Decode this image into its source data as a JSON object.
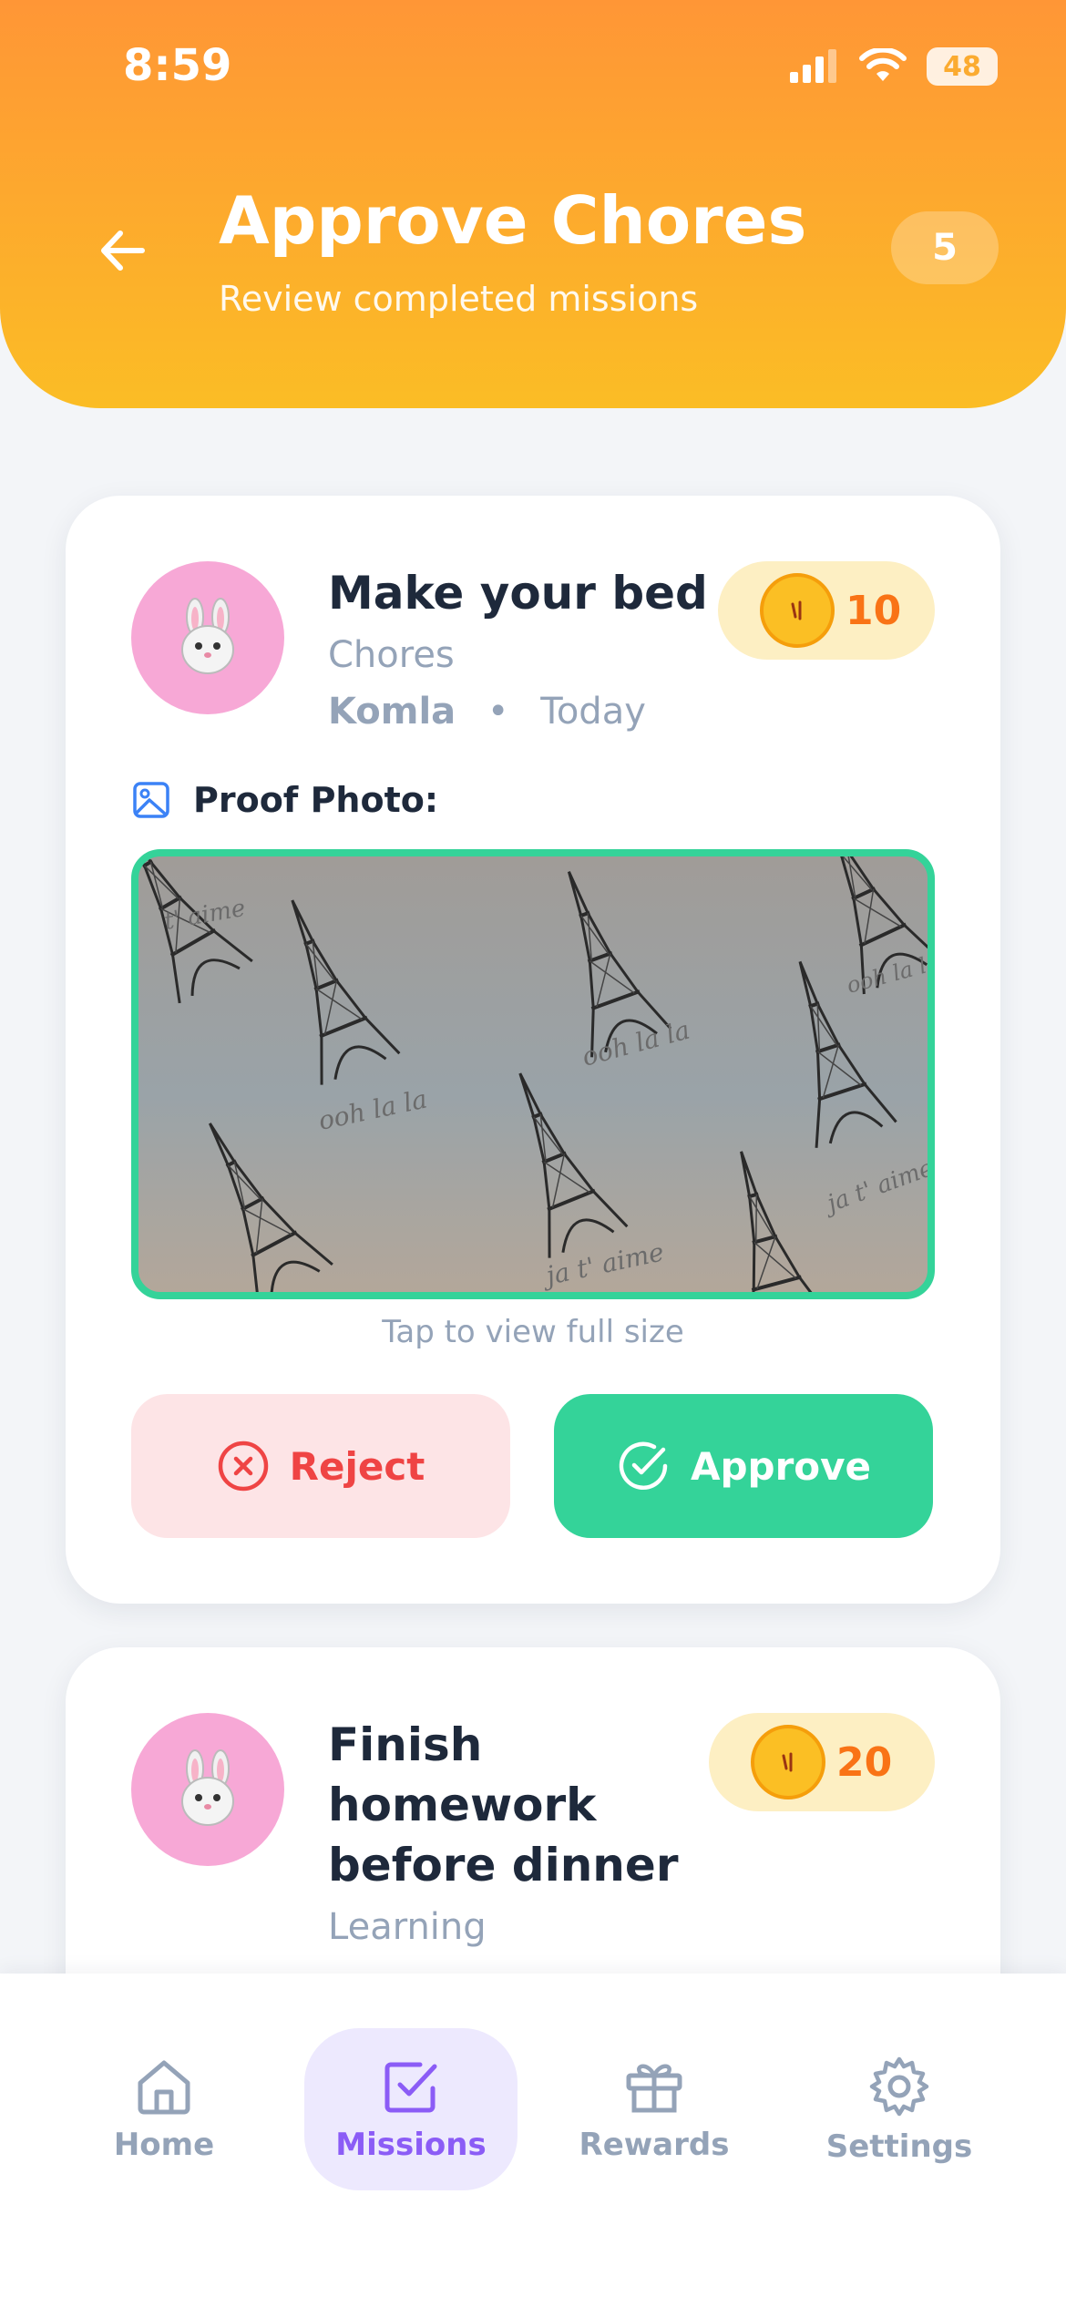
{
  "status_bar": {
    "time": "8:59",
    "battery": "48"
  },
  "header": {
    "title": "Approve Chores",
    "subtitle": "Review completed missions",
    "pending_count": "5"
  },
  "missions": [
    {
      "title": "Make your bed",
      "category": "Chores",
      "assignee": "Komla",
      "separator": "•",
      "date": "Today",
      "coins": "10",
      "proof_label": "Proof Photo:",
      "proof_caption_texts": [
        "t' aime",
        "ooh la la",
        "ooh la la",
        "ja t' aime",
        "ooh la la",
        "ja t' aime"
      ],
      "tap_hint": "Tap to view full size",
      "reject_label": "Reject",
      "approve_label": "Approve"
    },
    {
      "title_lines": [
        "Finish",
        "homework",
        "before dinner"
      ],
      "category": "Learning",
      "coins": "20"
    }
  ],
  "nav": [
    {
      "label": "Home",
      "icon": "home-icon"
    },
    {
      "label": "Missions",
      "icon": "check-square-icon",
      "active": true
    },
    {
      "label": "Rewards",
      "icon": "gift-icon"
    },
    {
      "label": "Settings",
      "icon": "gear-icon"
    }
  ],
  "colors": {
    "header_gradient_top": "#ff9636",
    "header_gradient_bottom": "#fbbd25",
    "approve": "#34d399",
    "reject": "#ef4444",
    "active_nav": "#8b5cf6",
    "coin_text": "#f97316"
  }
}
